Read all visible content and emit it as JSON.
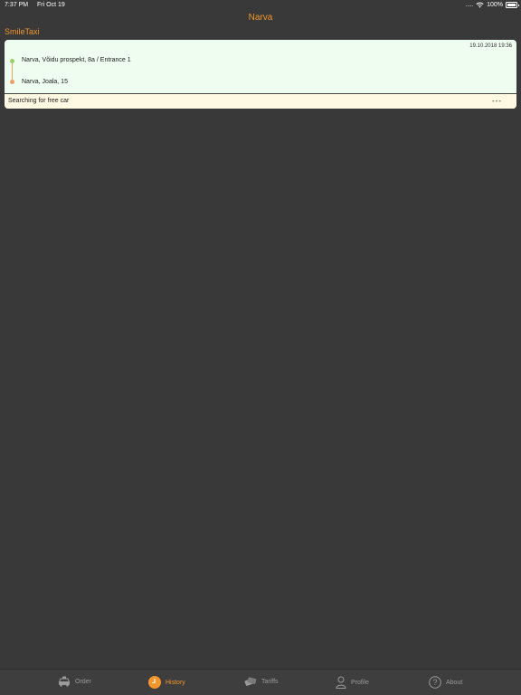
{
  "status_bar": {
    "time": "7:37 PM",
    "date": "Fri Oct 19",
    "signal": ".....",
    "battery": "100%"
  },
  "nav": {
    "title": "Narva"
  },
  "brand": {
    "name": "SmileTaxi"
  },
  "order_card": {
    "date": "19.10.2018 19:36",
    "from": "Narva, Võidu prospekt, 8a / Entrance 1",
    "to": "Narva, Joala, 15",
    "status_text": "Searching for free car",
    "status_value": "---"
  },
  "tabs": [
    {
      "label": "Order",
      "icon": "taxi-icon",
      "active": false
    },
    {
      "label": "History",
      "icon": "clock-icon",
      "active": true
    },
    {
      "label": "Tariffs",
      "icon": "tickets-icon",
      "active": false
    },
    {
      "label": "Profile",
      "icon": "person-icon",
      "active": false
    },
    {
      "label": "About",
      "icon": "question-icon",
      "active": false
    }
  ],
  "colors": {
    "accent": "#f2962d",
    "background": "#393939",
    "card_bg": "#eefdef",
    "status_bg": "#fff8e2",
    "from_dot": "#9ccf6a",
    "to_dot": "#ee9f68"
  }
}
